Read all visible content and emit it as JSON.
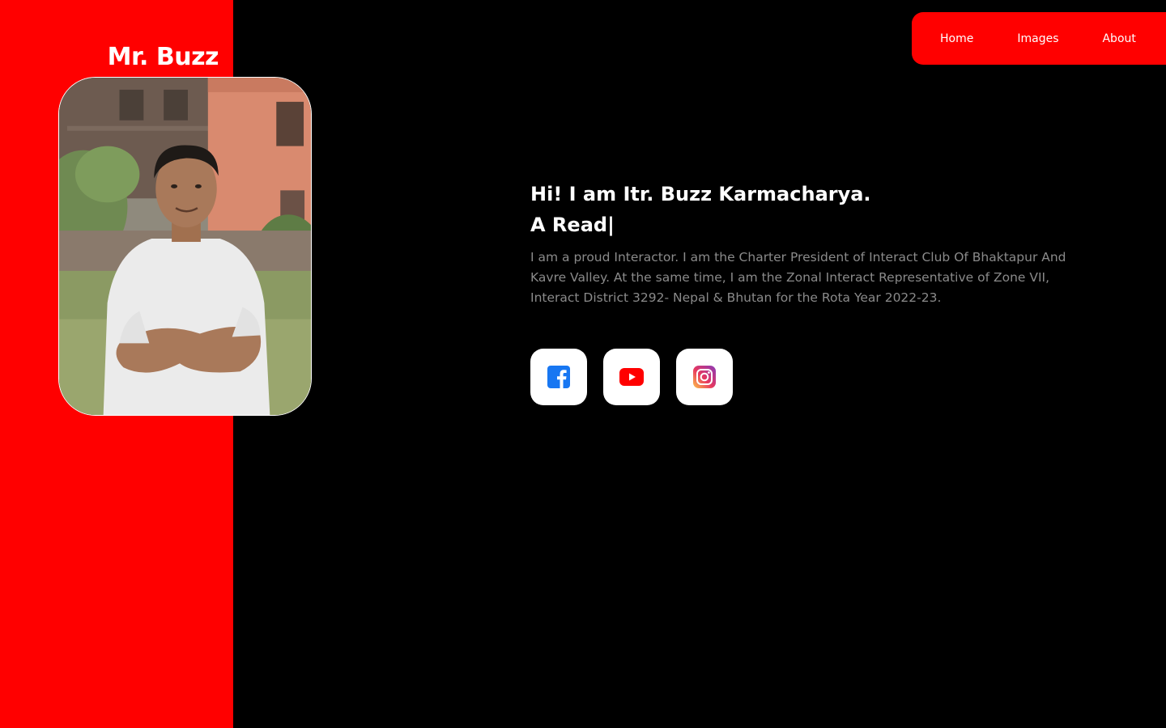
{
  "brand": {
    "name": "Mr. Buzz"
  },
  "nav": {
    "items": [
      {
        "label": "Home"
      },
      {
        "label": "Images"
      },
      {
        "label": "About"
      }
    ]
  },
  "hero": {
    "greeting": "Hi! I am Itr. Buzz Karmacharya.",
    "typing_text": "A Read|",
    "bio": "I am a proud Interactor. I am the Charter President of Interact Club Of Bhaktapur And Kavre Valley. At the same time, I am the Zonal Interact Representative of Zone VII, Interact District 3292- Nepal & Bhutan for the Rota Year 2022-23."
  },
  "profile_photo": {
    "subject": "smiling young man in white t-shirt with arms crossed"
  },
  "socials": [
    {
      "icon": "facebook-icon",
      "color": "#1877f2"
    },
    {
      "icon": "youtube-icon",
      "color": "#ff0000"
    },
    {
      "icon": "instagram-icon",
      "color": "#e1306c"
    }
  ],
  "colors": {
    "accent": "#ff0000",
    "background": "#000000",
    "text": "#ffffff",
    "muted_text": "#8a8a8a"
  }
}
